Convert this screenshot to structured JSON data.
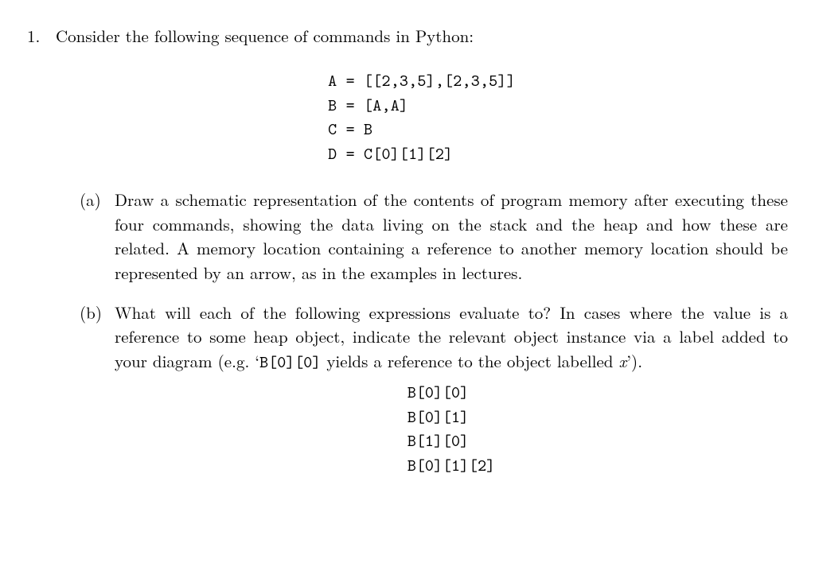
{
  "problem": {
    "number": "1.",
    "intro": "Consider the following sequence of commands in Python:",
    "code_lines": [
      "A = [[2,3,5],[2,3,5]]",
      "B = [A,A]",
      "C = B",
      "D = C[0][1][2]"
    ],
    "parts": {
      "a": {
        "label": "(a)",
        "text_pre": "Draw a schematic representation of the contents of program memory after executing these four commands, showing the data living on the stack and the heap and how these are related. A memory location containing a reference to another memory location should be represented by an arrow, as in the examples in lectures."
      },
      "b": {
        "label": "(b)",
        "text_pre": "What will each of the following expressions evaluate to?  In cases where the value is a reference to some heap object, indicate the relevant object instance via a label added to your diagram (e.g. ‘",
        "code_inline": "B[0][0]",
        "text_mid": " yields a reference to the object labelled ",
        "var": "x",
        "text_post": "’).",
        "expressions": [
          "B[0][0]",
          "B[0][1]",
          "B[1][0]",
          "B[0][1][2]"
        ]
      }
    }
  }
}
